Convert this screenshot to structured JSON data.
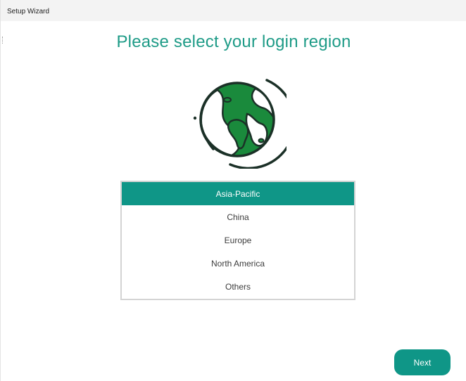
{
  "window": {
    "title": "Setup Wizard"
  },
  "main": {
    "heading": "Please select your login region",
    "icon": "globe-icon",
    "regions": [
      {
        "label": "Asia-Pacific",
        "selected": true
      },
      {
        "label": "China",
        "selected": false
      },
      {
        "label": "Europe",
        "selected": false
      },
      {
        "label": "North America",
        "selected": false
      },
      {
        "label": "Others",
        "selected": false
      }
    ]
  },
  "footer": {
    "next_label": "Next"
  },
  "colors": {
    "accent": "#0f9687",
    "heading": "#1e9b87",
    "globe_land": "#1a8a3c",
    "globe_outline": "#1b3027"
  }
}
